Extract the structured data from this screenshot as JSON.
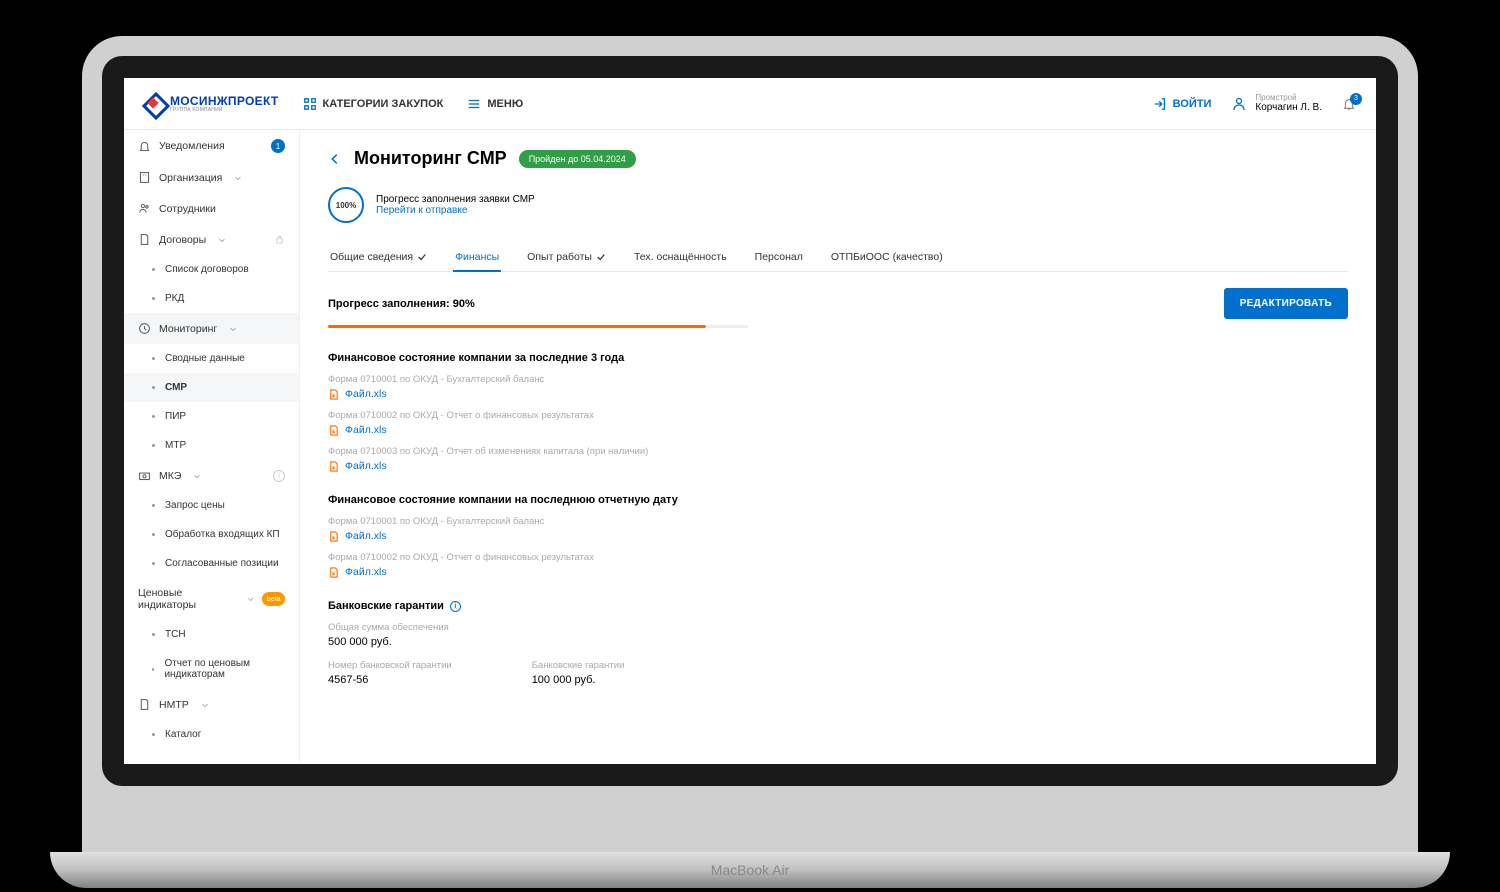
{
  "topbar": {
    "logo_text": "МОСИНЖПРОЕКТ",
    "logo_sub": "ГРУППА КОМПАНИЙ",
    "categories": "КАТЕГОРИИ ЗАКУПОК",
    "menu": "МЕНЮ",
    "login": "ВОЙТИ",
    "user_org": "Промстрой",
    "user_name": "Корчагин Л. В.",
    "bell_count": "3"
  },
  "sidebar": {
    "notifications": "Уведомления",
    "notifications_count": "1",
    "organization": "Организация",
    "employees": "Сотрудники",
    "contracts": "Договоры",
    "contracts_list": "Список договоров",
    "rkd": "РКД",
    "monitoring": "Мониторинг",
    "summary": "Сводные данные",
    "smr": "СМР",
    "pir": "ПИР",
    "mtr": "МТР",
    "mke": "МКЭ",
    "price_request": "Запрос цены",
    "kp_processing": "Обработка входящих КП",
    "agreed_positions": "Согласованные позиции",
    "price_indicators": "Ценовые индикаторы",
    "beta": "beta",
    "tsn": "ТСН",
    "indicator_report": "Отчет по ценовым индикаторам",
    "nmtr": "НМТР",
    "catalog": "Каталог"
  },
  "page": {
    "title": "Мониторинг СМР",
    "status": "Пройден до 05.04.2024",
    "progress_circle": "100%",
    "progress_text": "Прогресс заполнения заявки СМР",
    "progress_link": "Перейти к отправке",
    "tabs": {
      "general": "Общие сведения",
      "finance": "Финансы",
      "experience": "Опыт работы",
      "equipment": "Тех. оснащённость",
      "personnel": "Персонал",
      "quality": "ОТПБиООС (качество)"
    },
    "progress_label": "Прогресс заполнения: 90%",
    "edit_button": "РЕДАКТИРОВАТЬ"
  },
  "chart_data": {
    "type": "bar",
    "title": "Прогресс заполнения",
    "categories": [
      "Финансы"
    ],
    "values": [
      90
    ],
    "xlabel": "",
    "ylabel": "%",
    "ylim": [
      0,
      100
    ]
  },
  "sections": {
    "title1": "Финансовое состояние компании за последние 3 года",
    "form1_label": "Форма 0710001 по ОКУД - Бухгалтерский баланс",
    "form2_label": "Форма 0710002 по ОКУД - Отчет о финансовых результатах",
    "form3_label": "Форма 0710003 по ОКУД - Отчет об изменениях капитала (при наличии)",
    "file_name": "Файл.xls",
    "title2": "Финансовое состояние компании на последнюю отчетную дату",
    "title3": "Банковские гарантии",
    "total_label": "Общая сумма обеспечения",
    "total_value": "500 000 руб.",
    "number_label": "Номер банковской гарантии",
    "number_value": "4567-56",
    "bank_label": "Банковские гарантии",
    "bank_value": "100 000 руб."
  },
  "device": "MacBook Air"
}
